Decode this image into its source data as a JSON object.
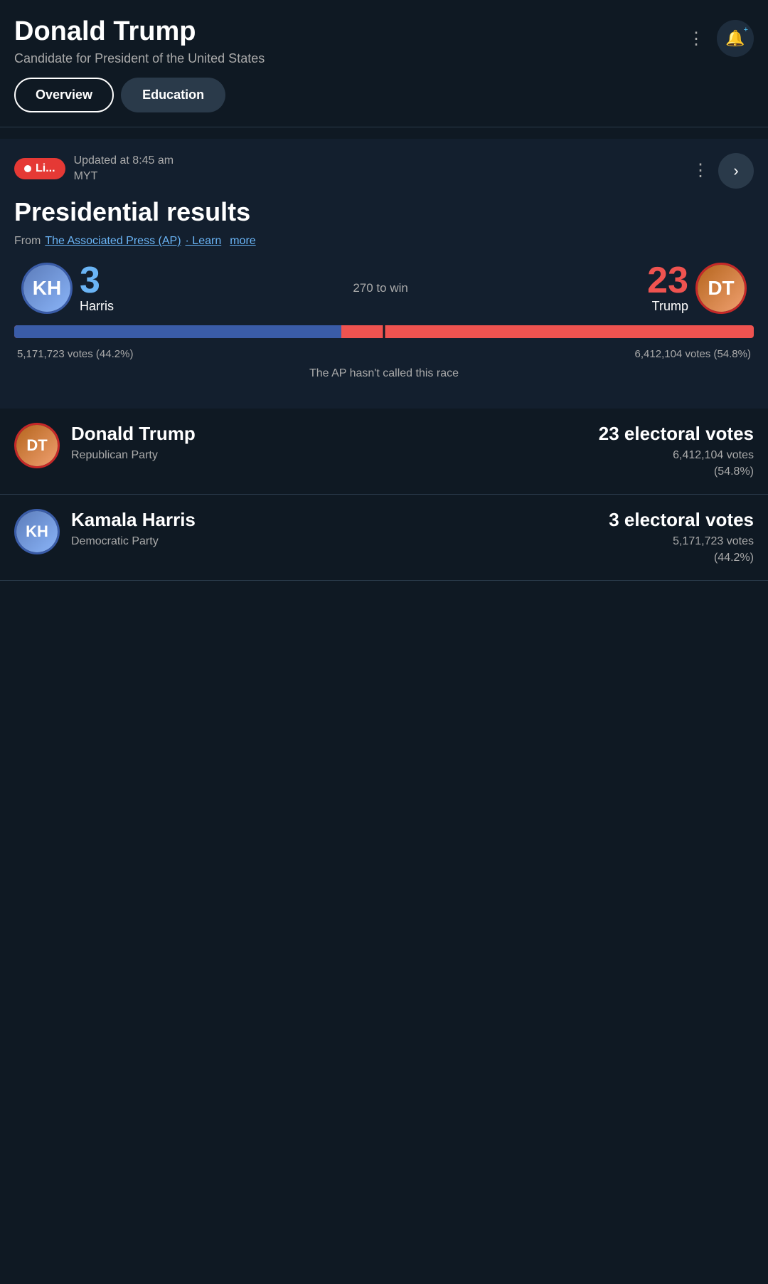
{
  "header": {
    "title": "Donald Trump",
    "subtitle": "Candidate for President of the United States",
    "more_options_label": "⋮",
    "bell_icon": "🔔"
  },
  "tabs": [
    {
      "id": "overview",
      "label": "Overview",
      "active": true
    },
    {
      "id": "education",
      "label": "Education",
      "active": false
    }
  ],
  "live_card": {
    "live_badge": "Li...",
    "updated_time": "Updated at 8:45 am",
    "timezone": "MYT",
    "title": "Presidential results",
    "source_text": "From",
    "source_name": "The Associated Press (AP)",
    "learn_text": "· Learn",
    "more_text": "more"
  },
  "election": {
    "harris": {
      "name": "Harris",
      "full_name": "Kamala Harris",
      "electoral_votes": 3,
      "popular_votes": "5,171,723 votes (44.2%)",
      "popular_votes_short": "5,171,723 votes",
      "percentage": "(44.2%)",
      "party": "Democratic Party",
      "electoral_label": "3 electoral votes"
    },
    "trump": {
      "name": "Trump",
      "full_name": "Donald Trump",
      "electoral_votes": 23,
      "popular_votes": "6,412,104 votes (54.8%)",
      "popular_votes_short": "6,412,104 votes",
      "percentage": "(54.8%)",
      "party": "Republican Party",
      "electoral_label": "23 electoral votes"
    },
    "threshold": "270 to win",
    "harris_bar_pct": 44.2,
    "trump_bar_pct": 54.8,
    "ap_notice": "The AP hasn't called this race"
  }
}
